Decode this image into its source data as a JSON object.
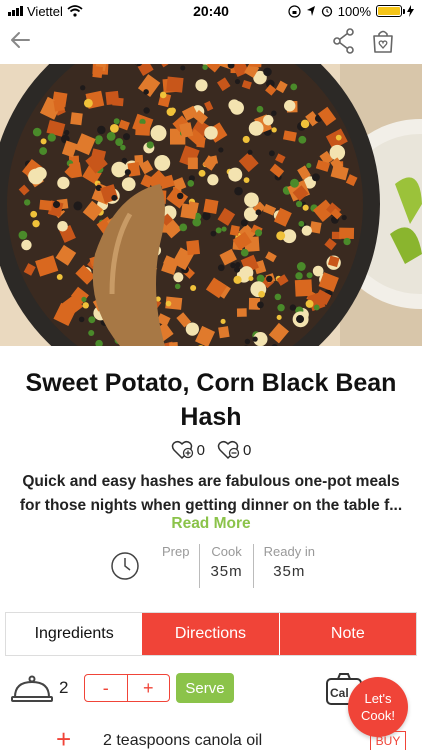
{
  "status_bar": {
    "carrier": "Viettel",
    "time": "20:40",
    "battery": "100%",
    "battery_level": 1.0
  },
  "recipe": {
    "title": "Sweet Potato, Corn   Black Bean Hash",
    "likes": "0",
    "dislikes": "0",
    "description": "Quick and easy hashes are fabulous one-pot meals for those nights when getting dinner on the table f...",
    "read_more": "Read More",
    "times": {
      "prep_label": "Prep",
      "prep_value": "",
      "cook_label": "Cook",
      "cook_value": "35m",
      "ready_label": "Ready in",
      "ready_value": "35m"
    }
  },
  "tabs": [
    {
      "label": "Ingredients",
      "active": true
    },
    {
      "label": "Directions",
      "active": false
    },
    {
      "label": "Note",
      "active": false
    }
  ],
  "servings": {
    "count": "2",
    "minus": "-",
    "plus": "+",
    "serve_label": "Serve",
    "calc_label": "Cal"
  },
  "lets_cook": "Let's Cook!",
  "ingredients": [
    {
      "text": "2 teaspoons canola oil",
      "buy_label": "BUY"
    }
  ],
  "colors": {
    "accent": "#f04438",
    "green": "#8bc34a"
  },
  "icons": {
    "back": "arrow-left",
    "share": "share",
    "bag": "shopping-bag-heart",
    "like": "heart-plus",
    "dislike": "heart-minus",
    "clock": "clock",
    "cloche": "serving-cloche",
    "calc": "calculator"
  }
}
